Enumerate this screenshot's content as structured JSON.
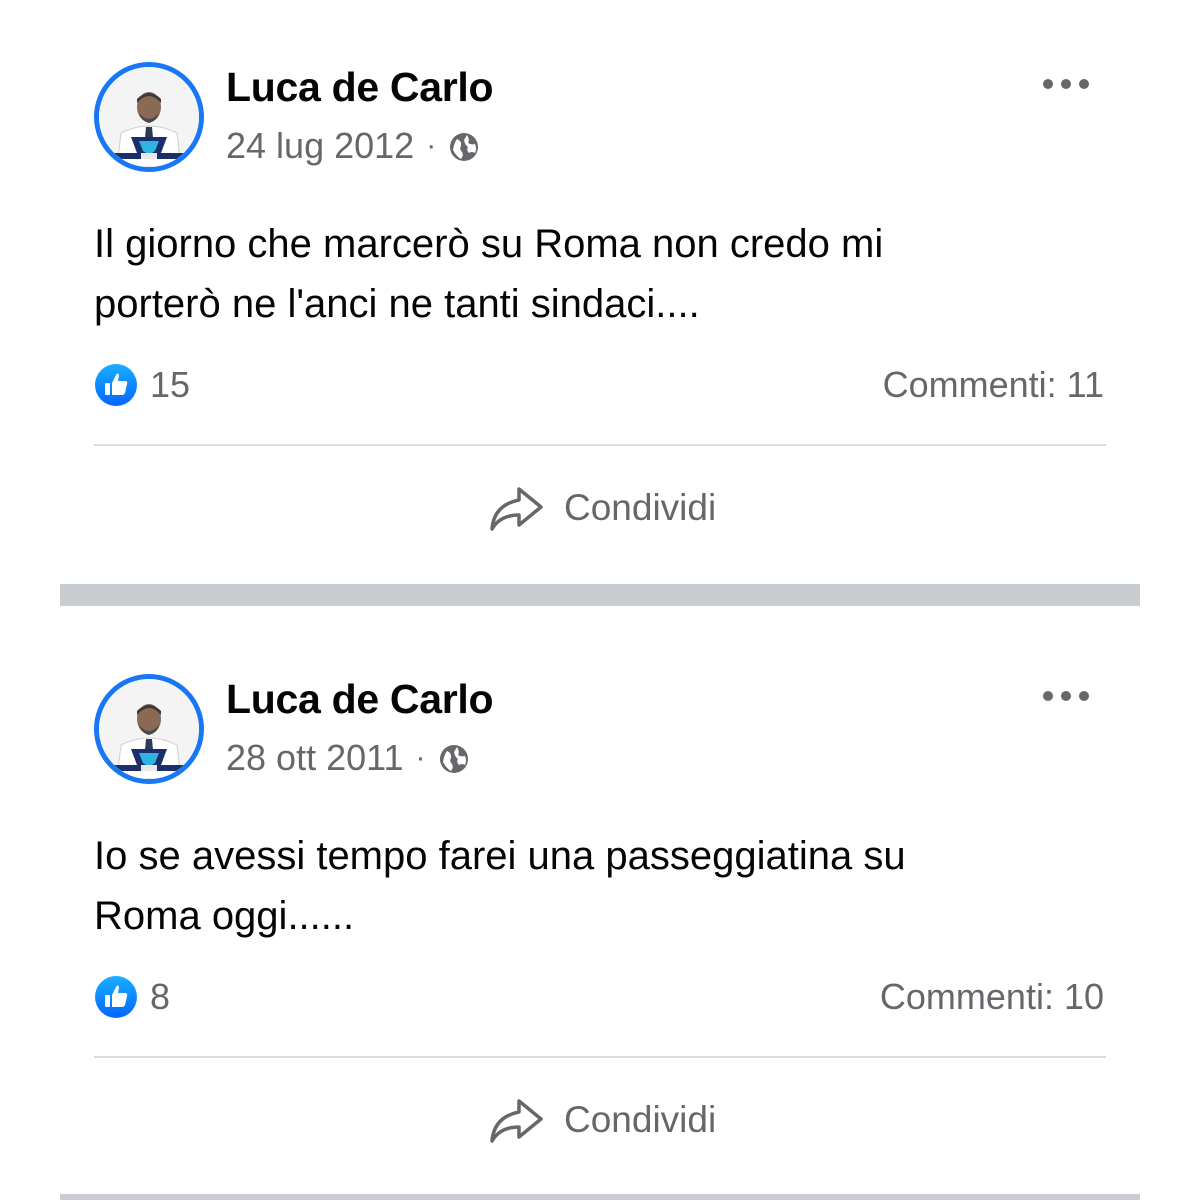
{
  "posts": [
    {
      "author": "Luca de Carlo",
      "date": "24 lug 2012",
      "separator": "·",
      "privacy_icon": "globe-icon",
      "text": "Il giorno che marcerò su Roma non credo mi\nporterò ne l'anci ne tanti sindaci....",
      "likes": "15",
      "comments": "Commenti: 11",
      "share_label": "Condividi"
    },
    {
      "author": "Luca de Carlo",
      "date": "28 ott 2011",
      "separator": "·",
      "privacy_icon": "globe-icon",
      "text": "Io se avessi tempo farei una passeggiatina su\nRoma oggi......",
      "likes": "8",
      "comments": "Commenti: 10",
      "share_label": "Condividi"
    }
  ],
  "colors": {
    "accent": "#1877f2",
    "secondary_text": "#65676b",
    "divider": "#dadde1",
    "section_separator": "#c9ccd1"
  }
}
